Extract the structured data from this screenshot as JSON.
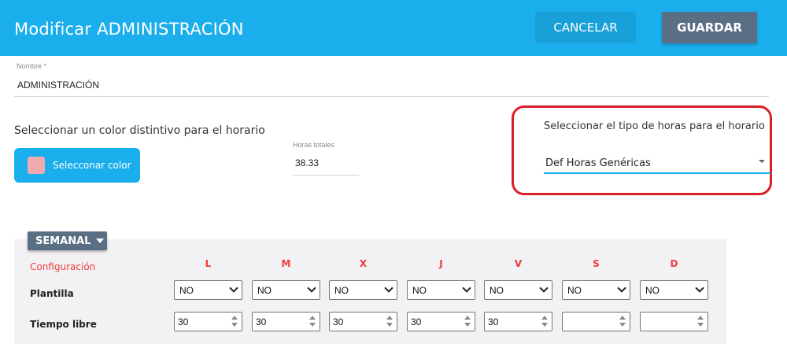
{
  "header": {
    "title": "Modificar ADMINISTRACIÓN",
    "cancel_label": "CANCELAR",
    "save_label": "GUARDAR",
    "accent_color": "#1aaeec",
    "save_color": "#5a6e84"
  },
  "nombre": {
    "label": "Nombre *",
    "value": "ADMINISTRACIÓN"
  },
  "color": {
    "label": "Seleccionar un color distintivo para el horario",
    "button_label": "Selecconar color",
    "swatch_color": "#f1aab0"
  },
  "horas": {
    "label": "Horas totales",
    "value": "38.33"
  },
  "tipo_horas": {
    "label": "Seleccionar el tipo de horas para el horario",
    "value": "Def Horas Genéricas",
    "highlight_color": "#dc1e26"
  },
  "schedule": {
    "mode_label": "SEMANAL",
    "config_label": "Configuración",
    "days": [
      "L",
      "M",
      "X",
      "J",
      "V",
      "S",
      "D"
    ],
    "plantilla_label": "Plantilla",
    "plantilla_values": [
      "NO",
      "NO",
      "NO",
      "NO",
      "NO",
      "NO",
      "NO"
    ],
    "tiempo_libre_label": "Tiempo libre",
    "tiempo_libre_values": [
      "30",
      "30",
      "30",
      "30",
      "30",
      "",
      ""
    ]
  }
}
